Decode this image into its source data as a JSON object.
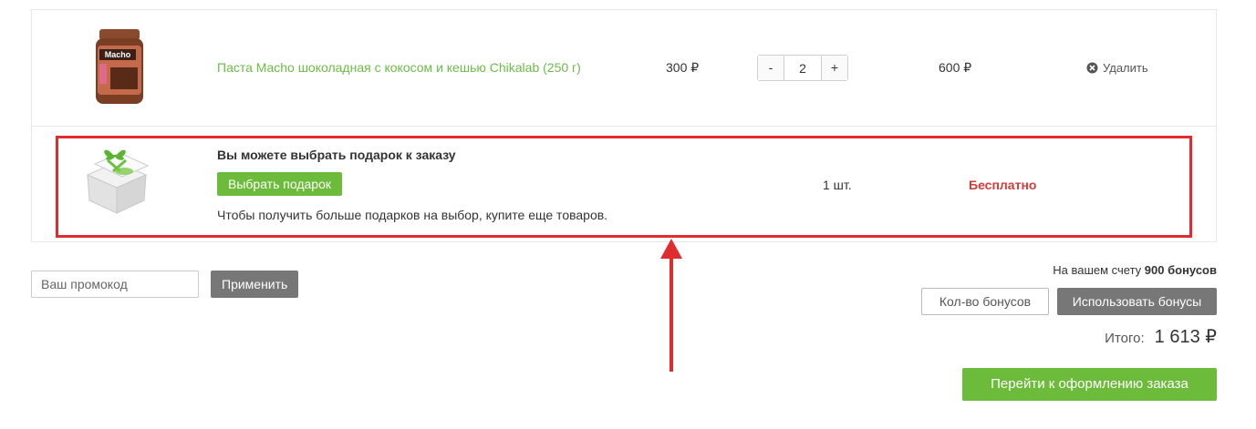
{
  "cart": {
    "product": {
      "name": "Паста Macho шоколадная с кокосом и кешью Chikalab (250 г)",
      "jar_label": "Macho",
      "price": "300 ₽",
      "quantity": "2",
      "minus_label": "-",
      "plus_label": "+",
      "sum": "600 ₽",
      "remove_label": "Удалить"
    },
    "gift": {
      "title": "Вы можете выбрать подарок к заказу",
      "choose_label": "Выбрать подарок",
      "note": "Чтобы получить больше подарков на выбор, купите еще товаров.",
      "quantity": "1 шт.",
      "price": "Бесплатно"
    }
  },
  "promo": {
    "placeholder": "Ваш промокод",
    "apply_label": "Применить"
  },
  "bonus": {
    "info_prefix": "На вашем счету ",
    "info_amount": "900 бонусов",
    "amount_button": "Кол-во бонусов",
    "use_button": "Использовать бонусы"
  },
  "total": {
    "label": "Итого:",
    "value": "1 613 ₽"
  },
  "checkout_label": "Перейти к оформлению заказа",
  "colors": {
    "accent_green": "#6dbb3b",
    "highlight_red": "#e12c2f",
    "free_text_red": "#d63b3b",
    "button_gray": "#777777"
  }
}
